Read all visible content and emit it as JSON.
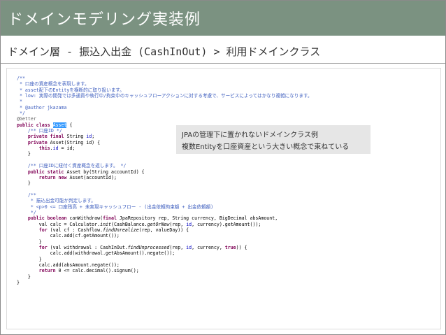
{
  "slide": {
    "title": "ドメインモデリング実装例",
    "subtitle": "ドメイン層 - 振込入出金 (CashInOut) > 利用ドメインクラス"
  },
  "callout": {
    "line1": "JPAの管理下に置かれないドメインクラス例",
    "line2": "複数Entityを口座資産という大きい概念で束ねている"
  },
  "code": {
    "l01": "/**",
    "l02": " * 口座の資産概念を表現します。",
    "l03": " * asset配下のEntityを横断的に取り扱います。",
    "l04": " * low: 実際の開発では多通貨や執行中/拘束中のキャッシュフローアクションに対する考慮で、サービスによってはかなり複雑になります。",
    "l05": " *",
    "l06": " * @author jkazama",
    "l07": " */",
    "l08": "@Getter",
    "l09a": "public class ",
    "l09sel": "Asset",
    "l09b": " {",
    "l10": "    /** 口座ID */",
    "l11a": "    private final ",
    "l11b": "String ",
    "l11c": "id",
    "l11d": ";",
    "l12a": "    private ",
    "l12b": "Asset(String id) {",
    "l13a": "        this",
    "l13b": ".",
    "l13c": "id",
    "l13d": " = id;",
    "l14": "    }",
    "l15": "",
    "l16": "    /** 口座IDに紐付く資産概念を返します。 */",
    "l17a": "    public static ",
    "l17b": "Asset by(String accountId) {",
    "l18a": "        return new ",
    "l18b": "Asset(accountId);",
    "l19": "    }",
    "l20": "",
    "l21": "    /**",
    "l22": "     * 振込出金可能か判定します。",
    "l23": "     * <p>0 <= 口座残高 + 未実現キャッシュフロー - (出金依頼拘束額 + 出金依頼額)",
    "l24": "     */",
    "l25a": "    public boolean ",
    "l25b": "canWithdraw(",
    "l25c": "final ",
    "l25d": "JpaRepository rep, String currency, BigDecimal absAmount,",
    "l26a": "        val calc = Calculator.",
    "l26b": "init",
    "l26c": "(CashBalance.",
    "l26d": "getOrNew",
    "l26e": "(rep, ",
    "l26f": "id",
    "l26g": ", currency).getAmount());",
    "l27a": "        for ",
    "l27b": "(val cf : Cashflow.",
    "l27c": "findUnrealize",
    "l27d": "(rep, valueDay)) {",
    "l28": "            calc.add(cf.getAmount());",
    "l29": "        }",
    "l30a": "        for ",
    "l30b": "(val withdrawal : CashInOut.",
    "l30c": "findUnprocessed",
    "l30d": "(rep, ",
    "l30e": "id",
    "l30f": ", currency, ",
    "l30g": "true",
    "l30h": ")) {",
    "l31": "            calc.add(withdrawal.getAbsAmount().negate());",
    "l32": "        }",
    "l33": "        calc.add(absAmount.negate());",
    "l34a": "        return ",
    "l34b": "0 <= calc.decimal().signum();",
    "l35": "    }",
    "l36": "}"
  },
  "colors": {
    "title_bar": "#7b9281",
    "comment": "#3f7f5f",
    "javadoc": "#3f5fbf",
    "keyword": "#7f0055",
    "field": "#0000c0",
    "selection": "#3399ff",
    "callout_bg": "#e6e6e6"
  }
}
